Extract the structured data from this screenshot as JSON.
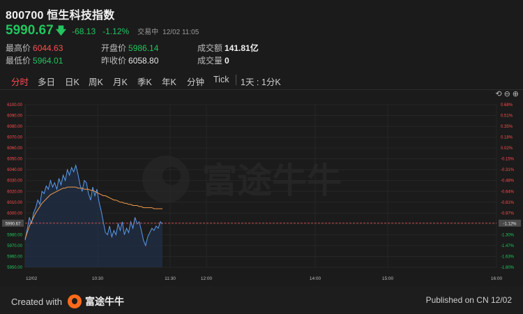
{
  "header": {
    "title": "800700 恒生科技指数",
    "price": "5990.67",
    "change": "-68.13",
    "change_pct": "-1.12%",
    "status": "交易中",
    "datetime": "12/02 11:05"
  },
  "stats": [
    {
      "label": "最高价",
      "value": "6044.63",
      "tone": "red"
    },
    {
      "label": "开盘价",
      "value": "5986.14",
      "tone": "green"
    },
    {
      "label": "成交额",
      "value": "141.81亿",
      "tone": "white"
    },
    {
      "label": "最低价",
      "value": "5964.01",
      "tone": "green"
    },
    {
      "label": "昨收价",
      "value": "6058.80",
      "tone": "white"
    },
    {
      "label": "成交量",
      "value": "0",
      "tone": "white"
    }
  ],
  "tabs": [
    {
      "label": "分时",
      "active": true
    },
    {
      "label": "多日"
    },
    {
      "label": "日K"
    },
    {
      "label": "周K"
    },
    {
      "label": "月K"
    },
    {
      "label": "季K"
    },
    {
      "label": "年K"
    },
    {
      "label": "分钟"
    },
    {
      "label": "Tick"
    }
  ],
  "range_label": "1天 : 1分K",
  "watermark": "富途牛牛",
  "chart_data": {
    "type": "line",
    "y_left": [
      "6100.00",
      "6090.00",
      "6080.00",
      "6070.00",
      "6060.00",
      "6050.00",
      "6040.00",
      "6030.00",
      "6020.00",
      "6010.00",
      "6000.00",
      "5990.00",
      "5980.00",
      "5970.00",
      "5960.00",
      "5950.00"
    ],
    "y_right": [
      "0.68%",
      "0.51%",
      "0.35%",
      "0.18%",
      "0.02%",
      "-0.15%",
      "-0.31%",
      "-0.48%",
      "-0.64%",
      "-0.81%",
      "-0.97%",
      "-1.12%",
      "-1.30%",
      "-1.47%",
      "-1.63%",
      "-1.80%"
    ],
    "x_labels": [
      "12/02",
      "10:30",
      "11:30",
      "12:00",
      "14:00",
      "15:00",
      "16:00"
    ],
    "ylim": [
      5950,
      6100
    ],
    "current_price_label": "5990.67",
    "current_pct_label": "-1.12%",
    "reference": 5990.67,
    "series": [
      {
        "values": [
          5975,
          5985,
          5996,
          5990,
          6000,
          6005,
          6012,
          6008,
          6020,
          6018,
          6025,
          6022,
          6030,
          6024,
          6028,
          6022,
          6032,
          6026,
          6035,
          6030,
          6040,
          6035,
          6042,
          6038,
          6044,
          6036,
          6026,
          6020,
          6030,
          6028,
          6018,
          6012,
          6024,
          6016,
          6022,
          6010,
          6002,
          5992,
          5982,
          5980,
          5988,
          5978,
          5984,
          5980,
          5990,
          5984,
          5992,
          5980,
          5986,
          5982,
          5992,
          5986,
          5996,
          5990,
          5992,
          5984,
          5975,
          5970,
          5978,
          5982,
          5986,
          5984,
          5988,
          5986,
          5992,
          5990
        ]
      },
      {
        "values": [
          5976,
          5982,
          5988,
          5992,
          5996,
          6000,
          6003,
          6006,
          6009,
          6011,
          6013,
          6015,
          6017,
          6018,
          6019,
          6020,
          6021,
          6022,
          6023,
          6023,
          6024,
          6024,
          6024,
          6024,
          6024,
          6023,
          6023,
          6023,
          6022,
          6022,
          6022,
          6021,
          6021,
          6020,
          6019,
          6018,
          6017,
          6016,
          6016,
          6015,
          6014,
          6013,
          6012,
          6012,
          6011,
          6010,
          6010,
          6009,
          6009,
          6008,
          6008,
          6007,
          6007,
          6007,
          6006,
          6006,
          6005,
          6005,
          6005,
          6005,
          6005,
          6004,
          6004,
          6004,
          6004,
          6004
        ]
      }
    ],
    "colors": {
      "price": "#5b9bf0",
      "avg": "#f29b48",
      "ref": "#d9534f",
      "up": "#ff4d4f",
      "down": "#22c55e"
    }
  },
  "footer": {
    "created_prefix": "Created with",
    "brand": "富途牛牛",
    "published": "Published on CN 12/02"
  }
}
